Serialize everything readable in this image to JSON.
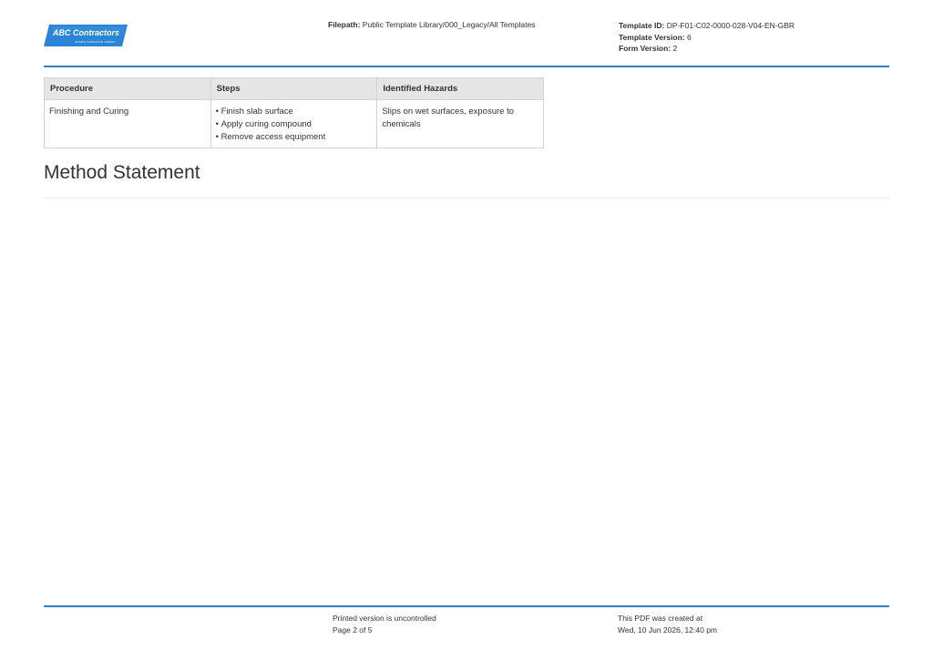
{
  "header": {
    "logo_text": "ABC Contractors",
    "logo_tagline": "EXAMPLE CONTRACTOR COMPANY",
    "filepath_label": "Filepath:",
    "filepath_value": "Public Template Library/000_Legacy/All Templates",
    "template_id_label": "Template ID:",
    "template_id_value": "DP-F01-C02-0000-028-V04-EN-GBR",
    "template_version_label": "Template Version:",
    "template_version_value": "6",
    "form_version_label": "Form Version:",
    "form_version_value": "2"
  },
  "table": {
    "headers": [
      "Procedure",
      "Steps",
      "Identified Hazards"
    ],
    "rows": [
      {
        "procedure": "Finishing and Curing",
        "steps": [
          "Finish slab surface",
          "Apply curing compound",
          "Remove access equipment"
        ],
        "hazards": "Slips on wet surfaces, exposure to chemicals"
      }
    ]
  },
  "section": {
    "title": "Method Statement"
  },
  "footer": {
    "uncontrolled": "Printed version is uncontrolled",
    "page": "Page 2 of 5",
    "created_label": "This PDF was created at",
    "created_value": "Wed, 10 Jun 2026, 12:40 pm"
  },
  "colors": {
    "accent": "#2f7fc1",
    "logo_bg": "#2a85d6",
    "table_header_bg": "#e6e6e6"
  }
}
